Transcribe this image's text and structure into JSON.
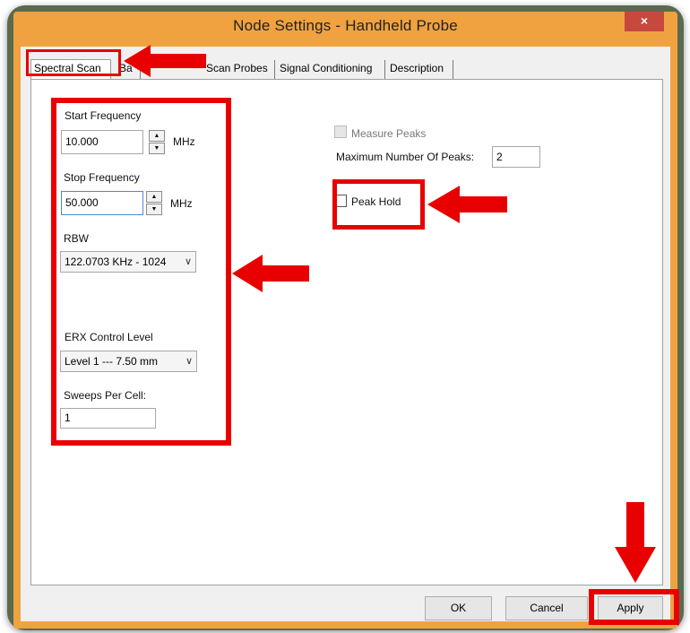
{
  "window": {
    "title": "Node Settings - Handheld Probe",
    "close_glyph": "×"
  },
  "tabs": [
    {
      "label": "Spectral Scan",
      "active": true
    },
    {
      "label": "Ba"
    },
    {
      "label": "Scan Probes"
    },
    {
      "label": "Signal Conditioning"
    },
    {
      "label": "Description"
    }
  ],
  "settings": {
    "start_frequency": {
      "label": "Start Frequency",
      "value": "10.000",
      "unit": "MHz"
    },
    "stop_frequency": {
      "label": "Stop Frequency",
      "value": "50.000",
      "unit": "MHz"
    },
    "rbw": {
      "label": "RBW",
      "selected": "122.0703 KHz - 1024"
    },
    "erx_control_level": {
      "label": "ERX Control Level",
      "selected": "Level 1 --- 7.50 mm"
    },
    "sweeps_per_cell": {
      "label": "Sweeps Per Cell:",
      "value": "1"
    }
  },
  "peaks": {
    "measure_peaks_label": "Measure Peaks",
    "measure_peaks_checked": false,
    "max_peaks_label": "Maximum Number Of Peaks:",
    "max_peaks_value": "2",
    "peak_hold_label": "Peak Hold",
    "peak_hold_checked": false
  },
  "buttons": {
    "ok": "OK",
    "cancel": "Cancel",
    "apply": "Apply"
  },
  "icons": {
    "spin_up": "▲",
    "spin_down": "▼",
    "dropdown": "∨"
  },
  "colors": {
    "highlight_red": "#e80000",
    "title_bar": "#f0a240",
    "frame": "#5b6a4f"
  }
}
